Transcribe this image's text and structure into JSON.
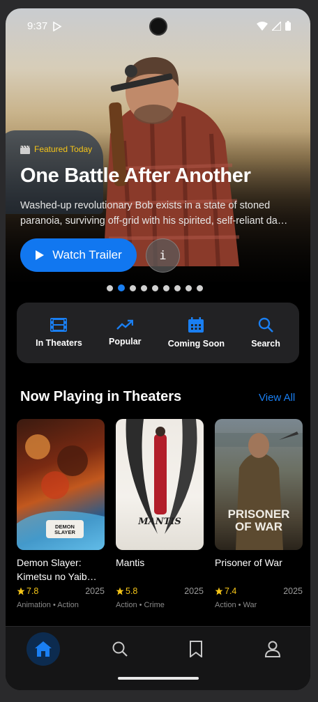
{
  "status_bar": {
    "time": "9:37"
  },
  "hero": {
    "featured_label": "Featured Today",
    "title": "One Battle After Another",
    "description_line1": "Washed-up revolutionary Bob exists in a state of stoned",
    "description_line2": "paranoia, surviving off-grid with his spirited, self-reliant da…",
    "watch_button_label": "Watch Trailer",
    "info_button_label": "i",
    "carousel_count": 9,
    "carousel_active_index": 1
  },
  "quick_nav": {
    "items": [
      {
        "label": "In Theaters",
        "icon": "film-icon"
      },
      {
        "label": "Popular",
        "icon": "trending-up-icon"
      },
      {
        "label": "Coming Soon",
        "icon": "calendar-icon"
      },
      {
        "label": "Search",
        "icon": "search-icon"
      }
    ]
  },
  "section": {
    "title": "Now Playing in Theaters",
    "view_all_label": "View All"
  },
  "movies": [
    {
      "title": "Demon Slayer: Kimetsu no Yaib…",
      "rating": "7.8",
      "year": "2025",
      "genres": "Animation • Action",
      "poster_text": "DEMON SLAYER"
    },
    {
      "title": "Mantis",
      "rating": "5.8",
      "year": "2025",
      "genres": "Action • Crime",
      "poster_text": "MANTIS"
    },
    {
      "title": "Prisoner of War",
      "rating": "7.4",
      "year": "2025",
      "genres": "Action • War",
      "poster_text": "PRISONER OF WAR"
    }
  ],
  "bottom_nav": {
    "items": [
      "home-icon",
      "search-icon",
      "bookmark-icon",
      "profile-icon"
    ],
    "active": "home-icon"
  },
  "colors": {
    "accent": "#1a7ff2",
    "star": "#f5c518",
    "card_bg": "#222224"
  }
}
